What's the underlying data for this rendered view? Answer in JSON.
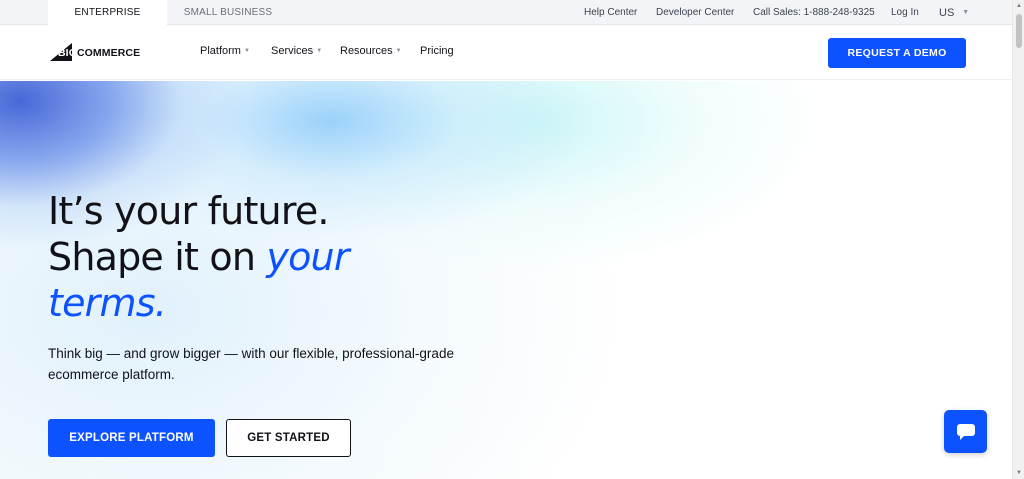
{
  "utility_bar": {
    "segment_tabs": [
      {
        "label": "ENTERPRISE",
        "active": true
      },
      {
        "label": "SMALL BUSINESS",
        "active": false
      }
    ],
    "links": {
      "help_center": "Help Center",
      "developer_center": "Developer Center",
      "call_sales": "Call Sales: 1-888-248-9325",
      "log_in": "Log In",
      "region": "US"
    }
  },
  "header": {
    "logo": {
      "big": "BIG",
      "commerce": "COMMERCE"
    },
    "nav": [
      {
        "label": "Platform",
        "has_dropdown": true
      },
      {
        "label": "Services",
        "has_dropdown": true
      },
      {
        "label": "Resources",
        "has_dropdown": true
      },
      {
        "label": "Pricing",
        "has_dropdown": false
      }
    ],
    "cta_label": "REQUEST A DEMO"
  },
  "hero": {
    "title_line1": "It’s your future.",
    "title_line2_plain": "Shape it on ",
    "title_line2_accent": "your",
    "title_line3_accent": "terms.",
    "subtitle": "Think big — and grow bigger — with our flexible, professional-grade ecommerce platform.",
    "primary_button": "EXPLORE PLATFORM",
    "secondary_button": "GET STARTED"
  },
  "chat_widget": {
    "icon": "chat-bubble-icon"
  },
  "colors": {
    "brand_blue": "#0d52ff",
    "text_dark": "#121118",
    "utility_bg": "#f2f4f7"
  }
}
